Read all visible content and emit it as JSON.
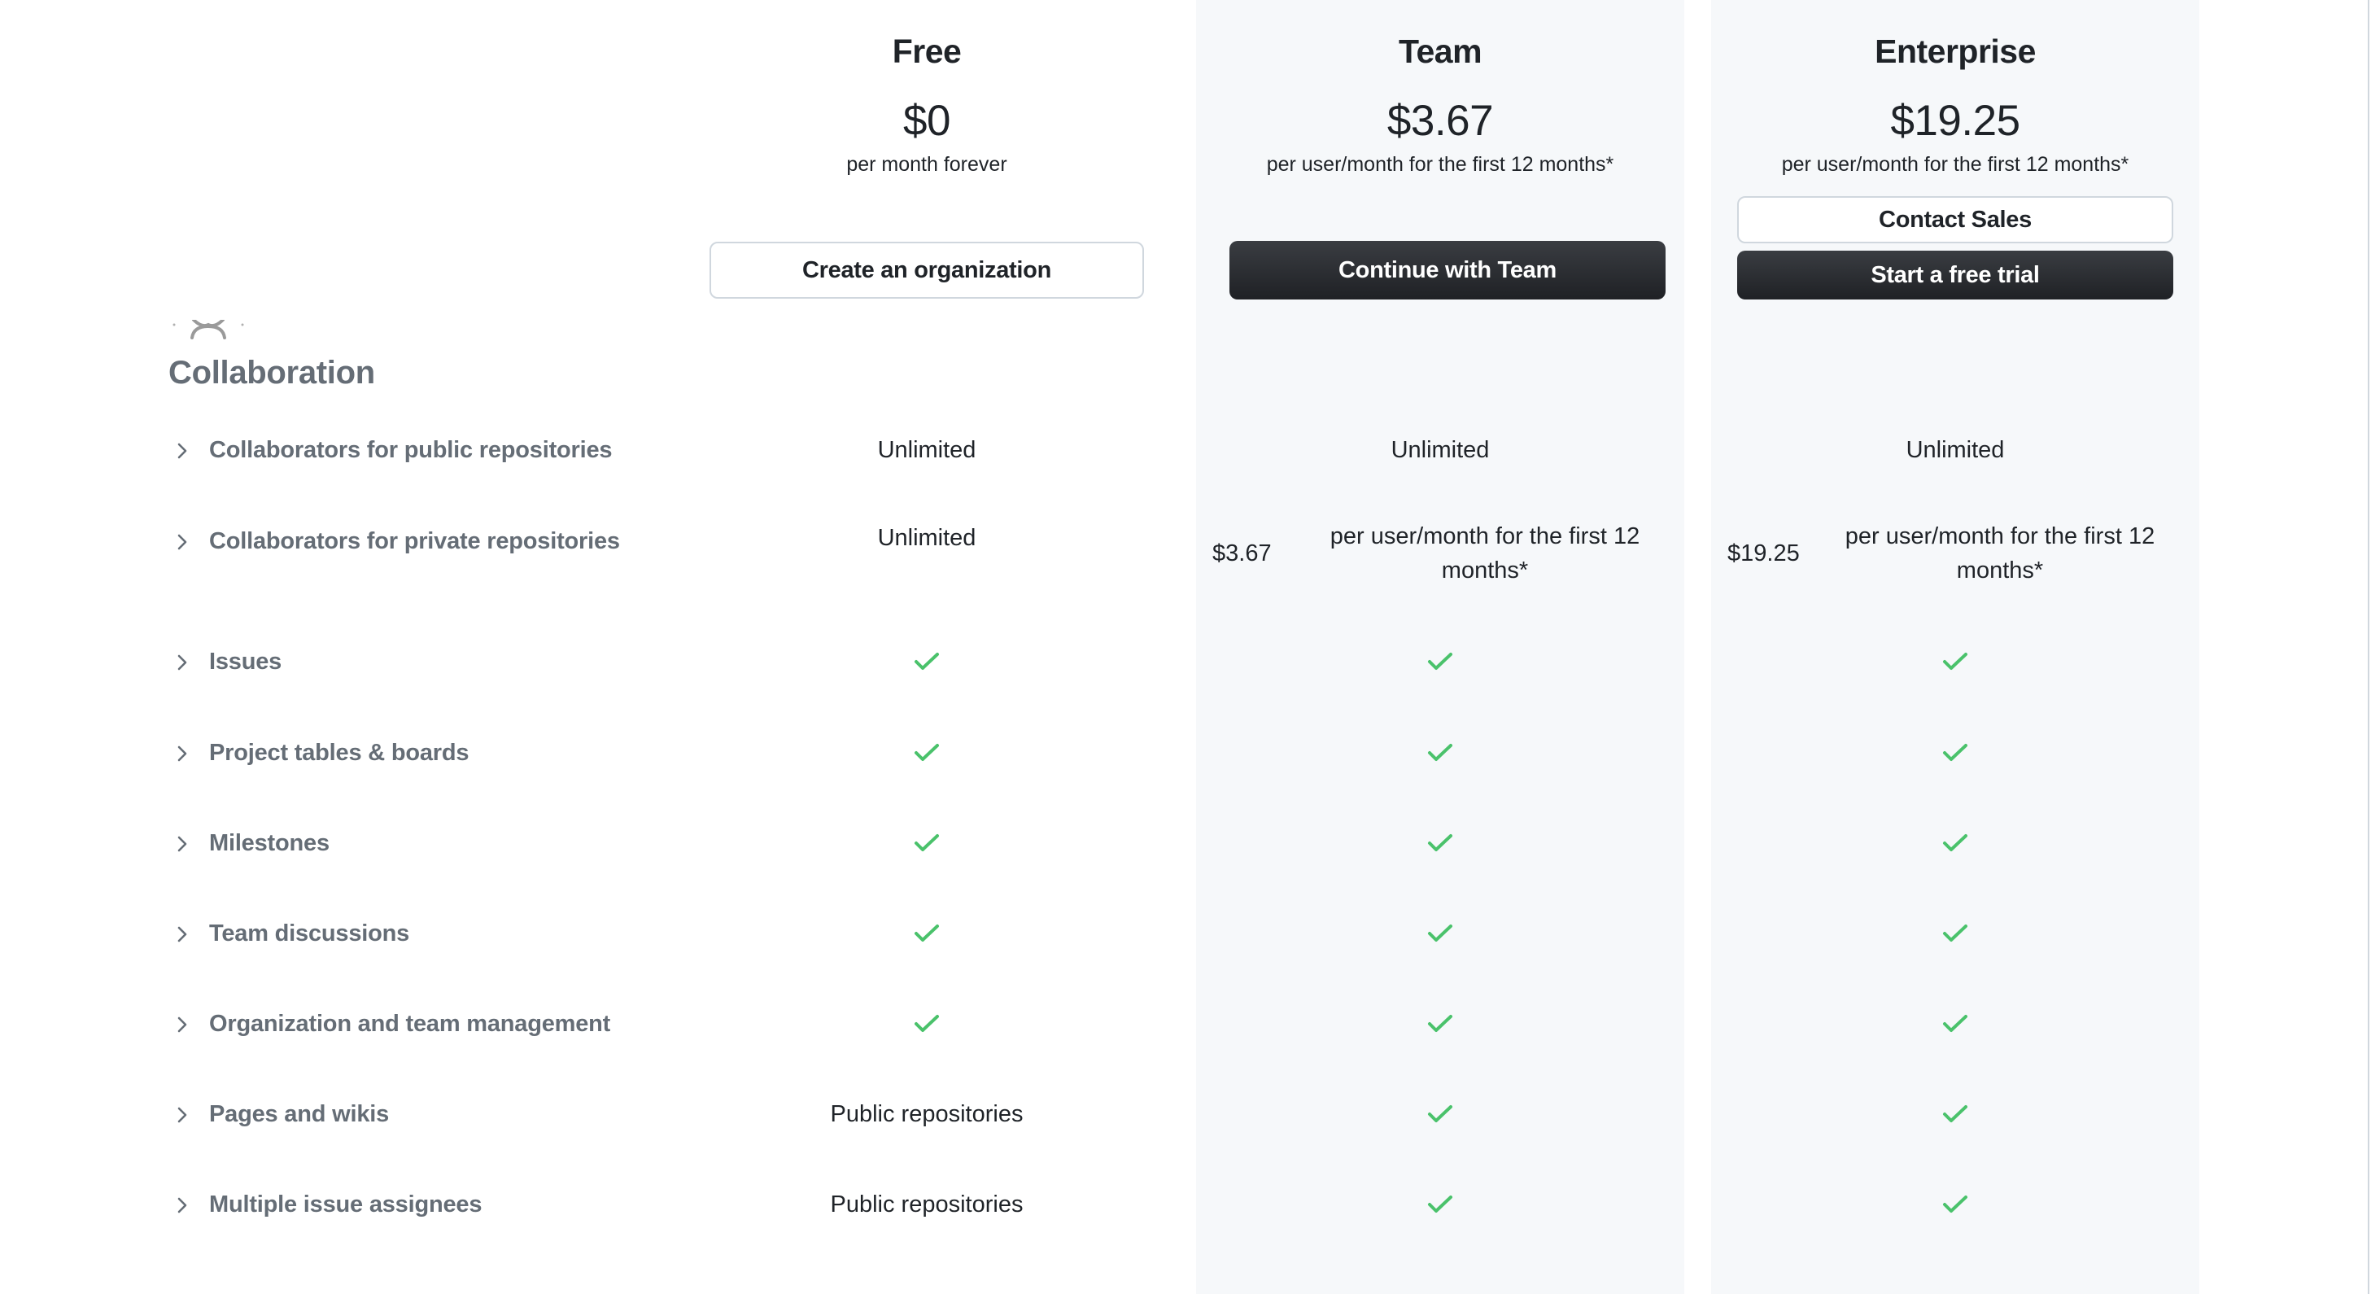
{
  "plans": [
    {
      "name": "Free",
      "price": "$0",
      "note": "per month forever",
      "buttons": [
        {
          "label": "Create an organization",
          "style": "outline"
        }
      ]
    },
    {
      "name": "Team",
      "price": "$3.67",
      "note": "per user/month for the first 12 months*",
      "buttons": [
        {
          "label": "Continue with Team",
          "style": "dark"
        }
      ]
    },
    {
      "name": "Enterprise",
      "price": "$19.25",
      "note": "per user/month for the first 12 months*",
      "buttons": [
        {
          "label": "Contact Sales",
          "style": "outline"
        },
        {
          "label": "Start a free trial",
          "style": "dark"
        }
      ]
    }
  ],
  "section": {
    "icon": "people-icon",
    "title": "Collaboration"
  },
  "features": [
    {
      "label": "Collaborators for public repositories",
      "free": "Unlimited",
      "team": "Unlimited",
      "enterprise": "Unlimited"
    },
    {
      "label": "Collaborators for private repositories",
      "free": "Unlimited",
      "team": {
        "amount": "$3.67",
        "text": "per user/month for the first 12 months*"
      },
      "enterprise": {
        "amount": "$19.25",
        "text": "per user/month for the first 12 months*"
      }
    },
    {
      "label": "Issues",
      "free": "check",
      "team": "check",
      "enterprise": "check"
    },
    {
      "label": "Project tables & boards",
      "free": "check",
      "team": "check",
      "enterprise": "check"
    },
    {
      "label": "Milestones",
      "free": "check",
      "team": "check",
      "enterprise": "check"
    },
    {
      "label": "Team discussions",
      "free": "check",
      "team": "check",
      "enterprise": "check"
    },
    {
      "label": "Organization and team management",
      "free": "check",
      "team": "check",
      "enterprise": "check"
    },
    {
      "label": "Pages and wikis",
      "free": "Public repositories",
      "team": "check",
      "enterprise": "check"
    },
    {
      "label": "Multiple issue assignees",
      "free": "Public repositories",
      "team": "check",
      "enterprise": "check"
    }
  ],
  "colors": {
    "text": "#1f2328",
    "muted": "#656d76",
    "check": "#4ac26b",
    "column_bg": "#f6f8fa",
    "button_dark": "#24292f",
    "border": "#d0d7de"
  }
}
